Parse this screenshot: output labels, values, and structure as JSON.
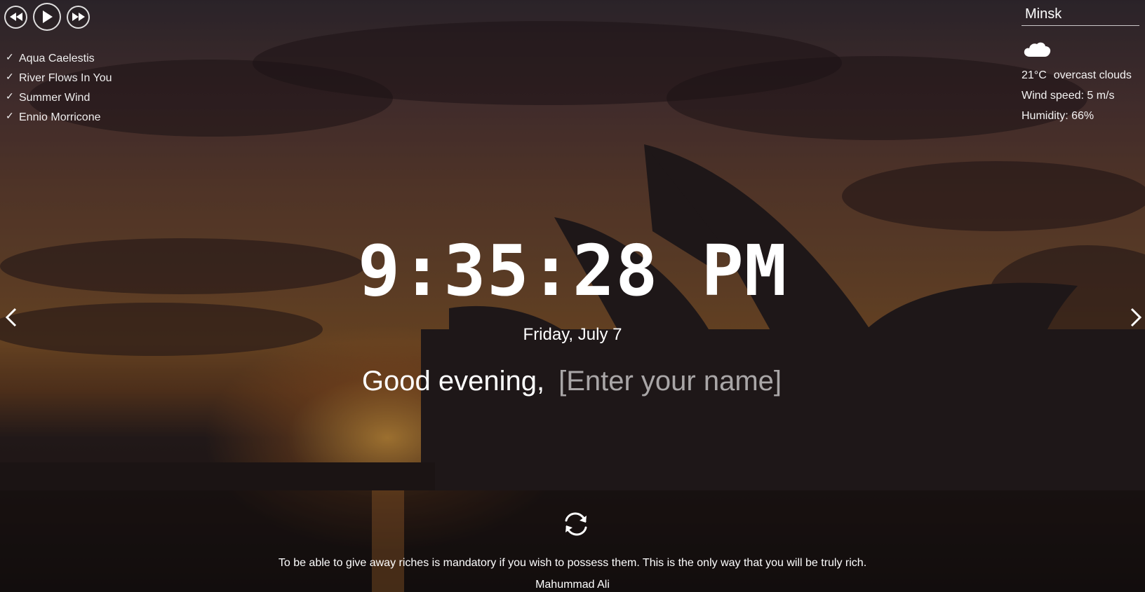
{
  "player": {
    "tracks": [
      "Aqua Caelestis",
      "River Flows In You",
      "Summer Wind",
      "Ennio Morricone"
    ],
    "check_glyph": "✓",
    "icons": [
      "rewind-icon",
      "play-icon",
      "fast-forward-icon"
    ]
  },
  "weather": {
    "city": "Minsk",
    "icon": "cloud-icon",
    "temperature": "21°C",
    "description": "overcast clouds",
    "wind": "Wind speed: 5 m/s",
    "humidity": "Humidity: 66%"
  },
  "clock": {
    "time": "9:35:28 PM",
    "date": "Friday, July 7"
  },
  "greeting": {
    "text": "Good evening,",
    "name_placeholder": "[Enter your name]"
  },
  "quote": {
    "text": "To be able to give away riches is mandatory if you wish to possess them. This is the only way that you will be truly rich.",
    "author": "Mahummad Ali"
  },
  "colors": {
    "sky_top": "#3b3139",
    "sunset_orange": "#f6b048",
    "text": "#ffffff"
  }
}
